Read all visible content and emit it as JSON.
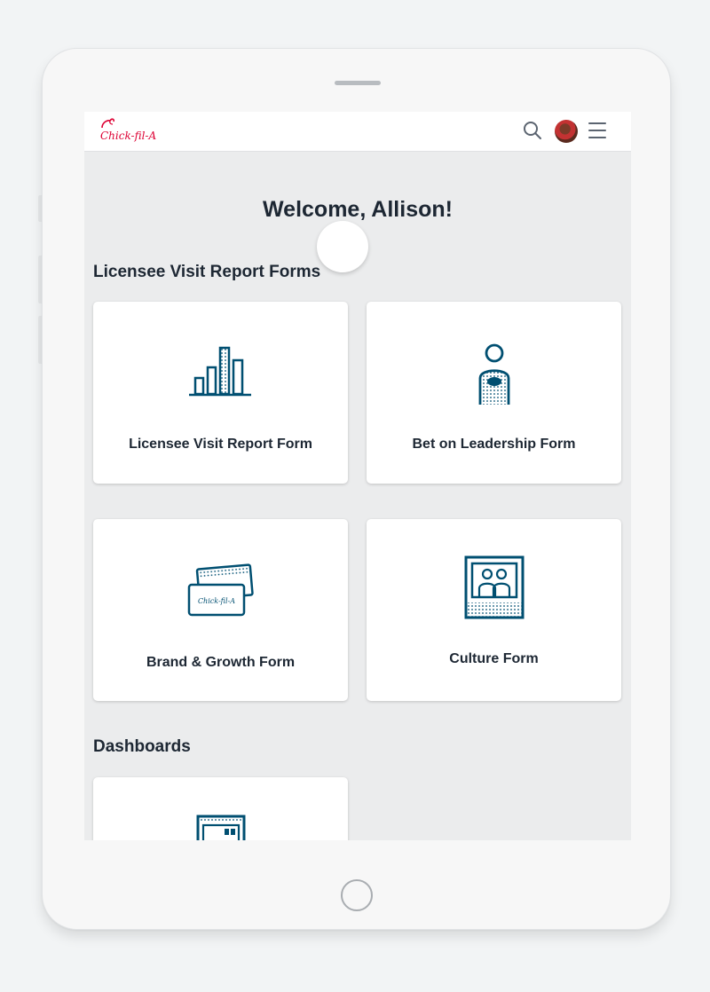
{
  "header": {
    "logo_text": "Chick-fil-A",
    "icons": [
      "search-icon",
      "avatar",
      "hamburger-menu-icon"
    ]
  },
  "welcome": "Welcome, Allison!",
  "sections": {
    "forms_title": "Licensee Visit Report Forms",
    "dashboards_title": "Dashboards"
  },
  "cards": [
    {
      "label": "Licensee Visit Report Form",
      "icon": "bar-chart-icon"
    },
    {
      "label": "Bet on Leadership Form",
      "icon": "person-icon"
    },
    {
      "label": "Brand & Growth Form",
      "icon": "gift-cards-icon"
    },
    {
      "label": "Culture Form",
      "icon": "picture-frame-icon"
    }
  ],
  "dashboard_card": {
    "icon": "dashboard-icon"
  },
  "colors": {
    "accent": "#004f71",
    "brand_red": "#dd0033",
    "background": "#ebeced",
    "text": "#1d2733"
  }
}
